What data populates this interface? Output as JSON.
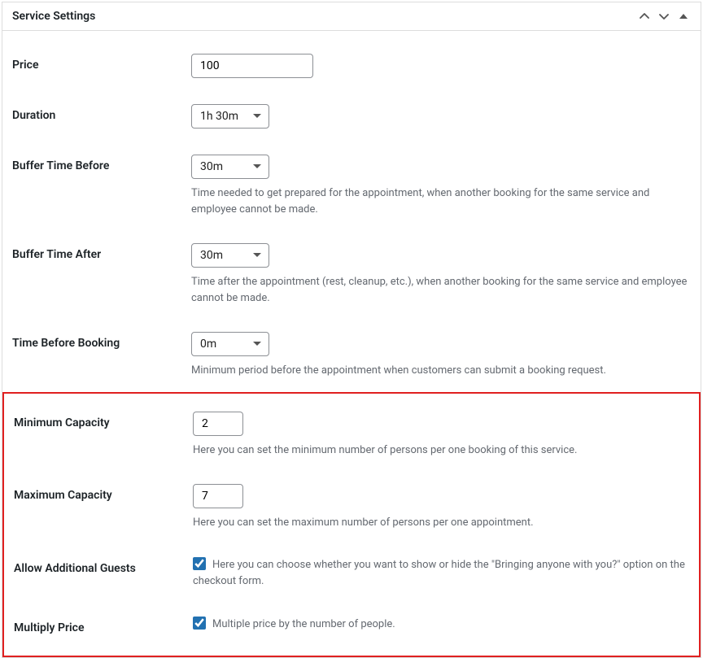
{
  "panel": {
    "title": "Service Settings"
  },
  "fields": {
    "price": {
      "label": "Price",
      "value": "100"
    },
    "duration": {
      "label": "Duration",
      "value": "1h 30m"
    },
    "buffer_before": {
      "label": "Buffer Time Before",
      "value": "30m",
      "desc": "Time needed to get prepared for the appointment, when another booking for the same service and employee cannot be made."
    },
    "buffer_after": {
      "label": "Buffer Time After",
      "value": "30m",
      "desc": "Time after the appointment (rest, cleanup, etc.), when another booking for the same service and employee cannot be made."
    },
    "time_before_booking": {
      "label": "Time Before Booking",
      "value": "0m",
      "desc": "Minimum period before the appointment when customers can submit a booking request."
    },
    "min_capacity": {
      "label": "Minimum Capacity",
      "value": "2",
      "desc": "Here you can set the minimum number of persons per one booking of this service."
    },
    "max_capacity": {
      "label": "Maximum Capacity",
      "value": "7",
      "desc": "Here you can set the maximum number of persons per one appointment."
    },
    "allow_guests": {
      "label": "Allow Additional Guests",
      "desc": "Here you can choose whether you want to show or hide the \"Bringing anyone with you?\" option on the checkout form."
    },
    "multiply_price": {
      "label": "Multiply Price",
      "desc": "Multiple price by the number of people."
    }
  }
}
